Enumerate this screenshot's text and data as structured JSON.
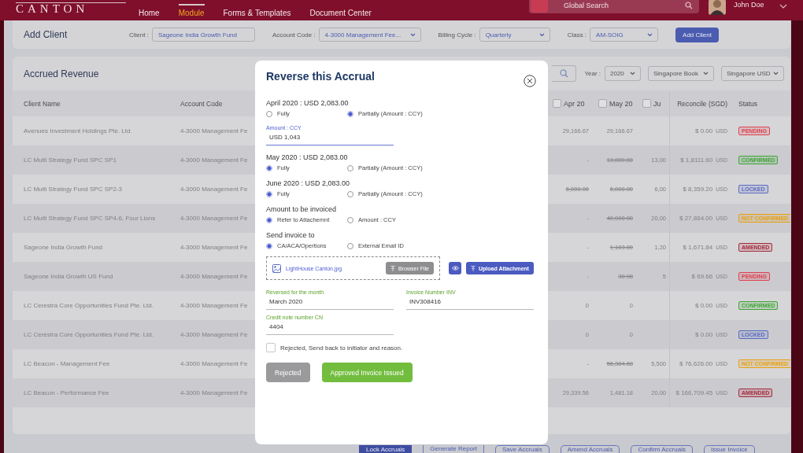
{
  "header": {
    "logo": "CANTON",
    "nav": [
      {
        "label": "Home",
        "selected": false
      },
      {
        "label": "Module",
        "selected": true
      },
      {
        "label": "Forms & Templates",
        "selected": false
      },
      {
        "label": "Document Center",
        "selected": false
      }
    ],
    "search": {
      "placeholder": "Global Search"
    },
    "user": {
      "name": "John Doe"
    }
  },
  "add_client": {
    "title": "Add Client",
    "fields": [
      {
        "label": "Client :",
        "value": "Sageone India Growth Fund",
        "kind": "text"
      },
      {
        "label": "Account Code :",
        "value": "4-3000 Management Fee...",
        "kind": "select"
      },
      {
        "label": "Billing Cycle :",
        "value": "Quarterly",
        "kind": "select"
      },
      {
        "label": "Class :",
        "value": "AM-SOIG",
        "kind": "select"
      }
    ],
    "button": "Add Client"
  },
  "accrued_revenue": {
    "title": "Accrued Revenue",
    "year_label": "Year :",
    "year": "2020",
    "book": "Singapore Book",
    "currency": "Singapore USD",
    "columns": {
      "client": "Client Name",
      "account": "Account Code",
      "months": [
        {
          "label": "Apr 20",
          "checked": false
        },
        {
          "label": "May 20",
          "checked": false
        },
        {
          "label": "Ju",
          "checked": false
        }
      ],
      "reconcile": "Reconcile (SGD)",
      "status": "Status"
    },
    "rows": [
      {
        "client": "Avenues Investment Holdings Pte. Ltd.",
        "account": "4-3000 Management Fe",
        "months": [
          {
            "text": "29,166.67",
            "struck": false
          },
          {
            "text": "29,166.67",
            "struck": false
          }
        ],
        "reconcile": "$ 0.00",
        "unit": "USD",
        "status": {
          "label": "PENDING",
          "color": "#e0404f"
        }
      },
      {
        "client": "LC Multi Strategy Fund SPC SP1",
        "account": "4-3000 Management Fe",
        "months": [
          {
            "text": "-",
            "struck": false
          },
          {
            "text": "13,000.00",
            "struck": true
          },
          {
            "text": "13,00",
            "struck": false
          }
        ],
        "reconcile": "$ 1,8111.60",
        "unit": "USD",
        "status": {
          "label": "CONFIRMED",
          "color": "#3fa535"
        }
      },
      {
        "client": "LC Multi Strategy Fund SPC SP2-3",
        "account": "4-3000 Management Fe",
        "months": [
          {
            "text": "6,000.00",
            "struck": true
          },
          {
            "text": "6,000.00",
            "struck": true
          },
          {
            "text": "6,00",
            "struck": false
          }
        ],
        "reconcile": "$ 8,359.20",
        "unit": "USD",
        "status": {
          "label": "LOCKED",
          "color": "#5a6bc4"
        }
      },
      {
        "client": "LC Multi Strategy Fund SPC SP4-6, Four Lions",
        "account": "4-3000 Management Fe",
        "months": [
          {
            "text": "-",
            "struck": false
          },
          {
            "text": "40,000.00",
            "struck": true
          },
          {
            "text": "20,00",
            "struck": false
          }
        ],
        "reconcile": "$ 27,864.00",
        "unit": "USD",
        "status": {
          "label": "NOT CONFIRMED",
          "color": "#e8a012"
        }
      },
      {
        "client": "Sageone India Growth Fund",
        "account": "4-3000 Management Fe",
        "months": [
          {
            "text": "-",
            "struck": false
          },
          {
            "text": "1,183.80",
            "struck": true
          },
          {
            "text": "1,20",
            "struck": false
          }
        ],
        "reconcile": "$ 1,671.84",
        "unit": "USD",
        "status": {
          "label": "AMENDED",
          "color": "#a82a3c"
        }
      },
      {
        "client": "Sageone India Growth US Fund",
        "account": "4-3000 Management Fe",
        "months": [
          {
            "text": "-",
            "struck": false
          },
          {
            "text": "30.98",
            "struck": true
          },
          {
            "text": "5",
            "struck": false
          }
        ],
        "reconcile": "$ 69.66",
        "unit": "USD",
        "status": {
          "label": "PENDING",
          "color": "#e0404f"
        }
      },
      {
        "client": "LC Cerestra Core Opportunities Fund Pte. Ltd.",
        "account": "4-3000 Management Fe",
        "months": [
          {
            "text": "0",
            "struck": false
          },
          {
            "text": "0",
            "struck": false
          }
        ],
        "reconcile": "$ 0.00",
        "unit": "USD",
        "status": {
          "label": "CONFIRMED",
          "color": "#3fa535"
        }
      },
      {
        "client": "LC Cerestra Core Opportunities Fund Pte. Ltd.",
        "account": "4-3000 Management Fe",
        "months": [
          {
            "text": "0",
            "struck": false
          },
          {
            "text": "0",
            "struck": false
          }
        ],
        "reconcile": "$ 0.00",
        "unit": "USD",
        "status": {
          "label": "LOCKED",
          "color": "#5a6bc4"
        }
      },
      {
        "client": "LC Beacon - Management Fee",
        "account": "4-3000 Management Fe",
        "months": [
          {
            "text": "-",
            "struck": false
          },
          {
            "text": "56,384.68",
            "struck": true
          },
          {
            "text": "5,500",
            "struck": false
          }
        ],
        "reconcile": "$ 76,626.00",
        "unit": "USD",
        "status": {
          "label": "NOT CONFIRMED",
          "color": "#e8a012"
        }
      },
      {
        "client": "LC Beacon - Performance Fee",
        "account": "4-3000 Management Fe",
        "months": [
          {
            "text": "29,339.56",
            "struck": false
          },
          {
            "text": "1,481.18",
            "struck": false
          },
          {
            "text": "20,00",
            "struck": false
          }
        ],
        "reconcile": "$ 166,709.45",
        "unit": "USD",
        "status": {
          "label": "AMENDED",
          "color": "#a82a3c"
        }
      }
    ]
  },
  "actions": [
    {
      "label": "Lock Accruals",
      "kind": "primary"
    },
    {
      "label": "Generate Report",
      "kind": "plain"
    },
    {
      "label": "Save Accruals",
      "kind": "outline"
    },
    {
      "label": "Amend Accruals",
      "kind": "outline"
    },
    {
      "label": "Confirm Accruals",
      "kind": "outline"
    },
    {
      "label": "Issue Invoice",
      "kind": "outline"
    }
  ],
  "modal": {
    "title": "Reverse this Accrual",
    "groups": [
      {
        "heading": "April 2020 : USD 2,083.00",
        "options": [
          {
            "label": "Fully",
            "selected": false
          },
          {
            "label": "Partially (Amount : CCY)",
            "selected": true
          }
        ],
        "amount": {
          "label": "Amount : CCY",
          "value": "USD 1,043"
        }
      },
      {
        "heading": "May 2020 : USD 2,083.00",
        "options": [
          {
            "label": "Fully",
            "selected": true
          },
          {
            "label": "Partially (Amount : CCY)",
            "selected": false
          }
        ]
      },
      {
        "heading": "June 2020 : USD 2,083.00",
        "options": [
          {
            "label": "Fully",
            "selected": true
          },
          {
            "label": "Partially (Amount : CCY)",
            "selected": false
          }
        ]
      },
      {
        "heading": "Amount to be invoiced",
        "options": [
          {
            "label": "Refer to Attachemnt",
            "selected": true
          },
          {
            "label": "Amount : CCY",
            "selected": false
          }
        ]
      },
      {
        "heading": "Send invoice to",
        "options": [
          {
            "label": "CA/ACA/Opertions",
            "selected": true
          },
          {
            "label": "External Email ID",
            "selected": false
          }
        ]
      }
    ],
    "attachment": {
      "file": "LightHouse Canton.jpg",
      "browse": "Browser File",
      "upload": "Upload Attachment"
    },
    "fields": [
      {
        "label": "Reversed for the month",
        "value": "March 2020"
      },
      {
        "label": "Invoice Number INV",
        "value": "INV308416"
      },
      {
        "label": "Credit note number CN",
        "value": "4404"
      }
    ],
    "reject_check": {
      "label": "Rejected, Send back to initiator and reason.",
      "checked": false
    },
    "buttons": [
      {
        "label": "Rejected",
        "kind": "disabled"
      },
      {
        "label": "Approved Invoice Issued",
        "kind": "primary"
      }
    ]
  }
}
